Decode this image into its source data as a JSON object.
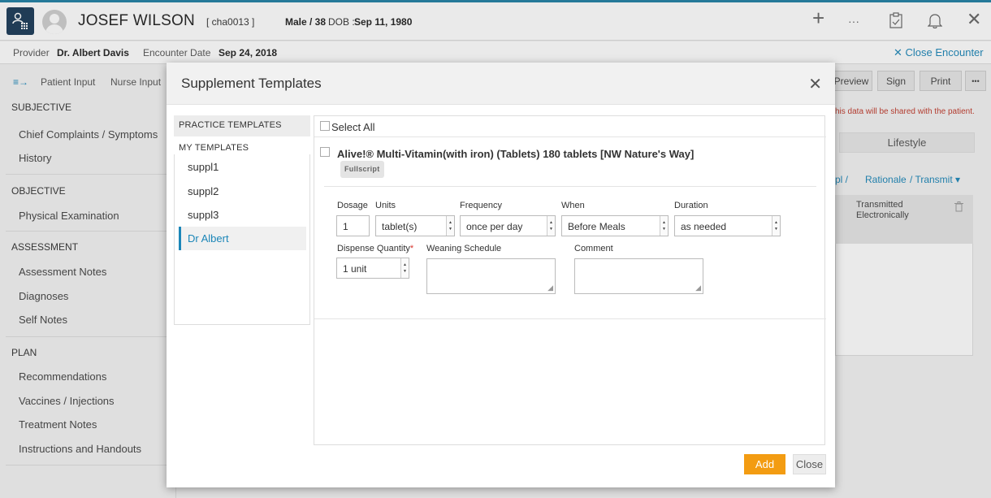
{
  "header": {
    "patient_name": "JOSEF WILSON",
    "patient_id": "[ cha0013 ]",
    "sex_age": "Male / 38",
    "dob_label": "DOB :",
    "dob": "Sep 11, 1980",
    "add_icon": "+",
    "more_icon": "···",
    "close_icon": "✕"
  },
  "provider_bar": {
    "provider_label": "Provider",
    "provider_name": "Dr. Albert Davis",
    "encounter_label": "Encounter Date",
    "encounter_date": "Sep 24, 2018",
    "close_encounter": "✕ Close Encounter"
  },
  "tabs": {
    "toggle_icon": "≡→",
    "patient_input": "Patient Input",
    "nurse_input": "Nurse Input",
    "preview": "Preview",
    "sign": "Sign",
    "print": "Print",
    "more": "•••"
  },
  "sidebar": {
    "subjective": "SUBJECTIVE",
    "chief_complaints": "Chief Complaints / Symptoms",
    "history": "History",
    "objective": "OBJECTIVE",
    "physical_exam": "Physical Examination",
    "assessment": "ASSESSMENT",
    "assessment_notes": "Assessment Notes",
    "diagnoses": "Diagnoses",
    "self_notes": "Self Notes",
    "plan": "PLAN",
    "recommendations": "Recommendations",
    "vaccines": "Vaccines / Injections",
    "treatment_notes": "Treatment Notes",
    "instructions": "Instructions and Handouts"
  },
  "right_panel": {
    "notice": "his data will be shared with the patient.",
    "lifestyle": "Lifestyle",
    "link_suppl": "pl /",
    "link_rationale": "Rationale",
    "link_transmit": "/ Transmit ▾",
    "transmitted": "Transmitted Electronically"
  },
  "modal": {
    "title": "Supplement Templates",
    "close_icon": "✕",
    "practice_templates": "PRACTICE TEMPLATES",
    "my_templates": "MY TEMPLATES",
    "templates": [
      "suppl1",
      "suppl2",
      "suppl3",
      "Dr Albert"
    ],
    "select_all": "Select All",
    "product": {
      "name": "Alive!® Multi-Vitamin(with iron) (Tablets) 180 tablets [NW Nature's Way]",
      "badge": "Fullscript"
    },
    "labels": {
      "dosage": "Dosage",
      "units": "Units",
      "frequency": "Frequency",
      "when": "When",
      "duration": "Duration",
      "dispense_quantity": "Dispense Quantity",
      "required_mark": "*",
      "weaning_schedule": "Weaning Schedule",
      "comment": "Comment"
    },
    "values": {
      "dosage": "1",
      "units": "tablet(s)",
      "frequency": "once per day",
      "when": "Before Meals",
      "duration": "as needed",
      "dispense_quantity": "1 unit"
    },
    "add_button": "Add",
    "close_button": "Close"
  },
  "colors": {
    "accent": "#1b86b8",
    "add_button": "#f39c12",
    "required": "#d9342b"
  }
}
